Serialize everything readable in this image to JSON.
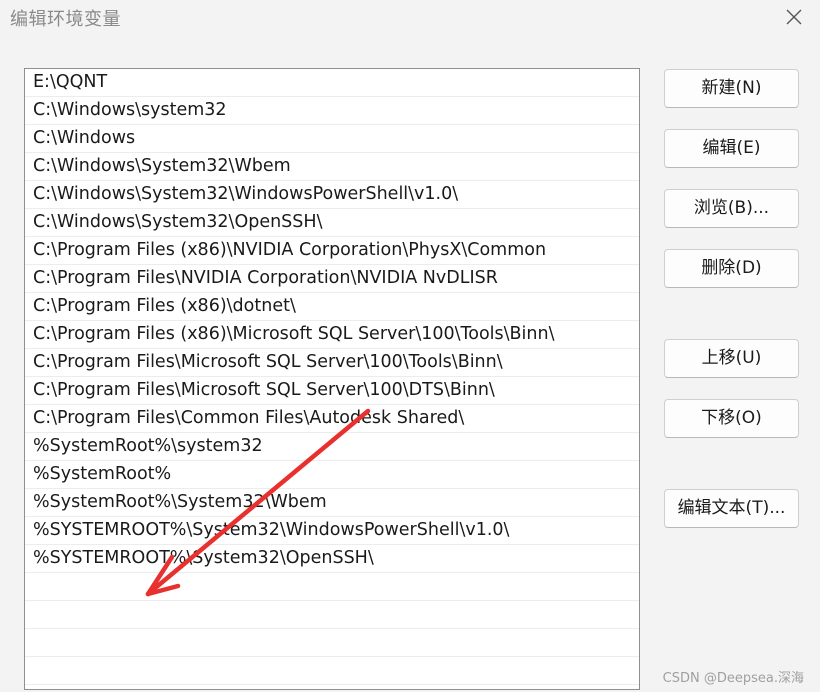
{
  "window": {
    "title": "编辑环境变量",
    "close_icon": "close-icon"
  },
  "list": {
    "items": [
      "E:\\QQNT",
      "C:\\Windows\\system32",
      "C:\\Windows",
      "C:\\Windows\\System32\\Wbem",
      "C:\\Windows\\System32\\WindowsPowerShell\\v1.0\\",
      "C:\\Windows\\System32\\OpenSSH\\",
      "C:\\Program Files (x86)\\NVIDIA Corporation\\PhysX\\Common",
      "C:\\Program Files\\NVIDIA Corporation\\NVIDIA NvDLISR",
      "C:\\Program Files (x86)\\dotnet\\",
      "C:\\Program Files (x86)\\Microsoft SQL Server\\100\\Tools\\Binn\\",
      "C:\\Program Files\\Microsoft SQL Server\\100\\Tools\\Binn\\",
      "C:\\Program Files\\Microsoft SQL Server\\100\\DTS\\Binn\\",
      "C:\\Program Files\\Common Files\\Autodesk Shared\\",
      "%SystemRoot%\\system32",
      "%SystemRoot%",
      "%SystemRoot%\\System32\\Wbem",
      "%SYSTEMROOT%\\System32\\WindowsPowerShell\\v1.0\\",
      "%SYSTEMROOT%\\System32\\OpenSSH\\",
      "",
      "",
      "",
      ""
    ]
  },
  "buttons": {
    "new": "新建(N)",
    "edit": "编辑(E)",
    "browse": "浏览(B)...",
    "delete": "删除(D)",
    "move_up": "上移(U)",
    "move_down": "下移(O)",
    "edit_text": "编辑文本(T)..."
  },
  "annotation": {
    "arrow_color": "#e8302f"
  },
  "watermark": "CSDN @Deepsea.深海"
}
